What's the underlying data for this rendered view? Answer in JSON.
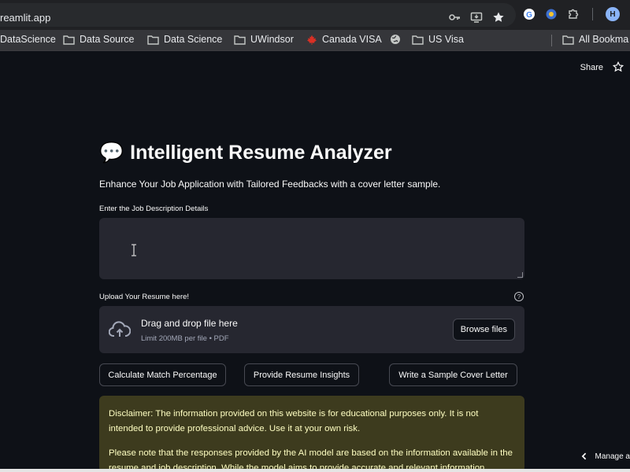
{
  "browser": {
    "url": "reamlit.app",
    "avatar_letter": "H",
    "bookmarks": [
      {
        "label": "DataScience",
        "icon": "folder-icon"
      },
      {
        "label": "Data Source",
        "icon": "folder-icon"
      },
      {
        "label": "Data Science",
        "icon": "folder-icon"
      },
      {
        "label": "UWindsor",
        "icon": "folder-icon"
      },
      {
        "label": "Canada VISA",
        "icon": "maple-leaf-icon"
      },
      {
        "label": "",
        "icon": "globe-icon"
      },
      {
        "label": "US Visa",
        "icon": "folder-icon"
      }
    ],
    "all_bookmarks": "All Bookma"
  },
  "toolbar": {
    "share": "Share"
  },
  "app": {
    "title_icon": "💬",
    "title": "Intelligent Resume Analyzer",
    "subtitle": "Enhance Your Job Application with Tailored Feedbacks with a cover letter sample.",
    "jd_label": "Enter the Job Description Details",
    "jd_value": "",
    "upload_label": "Upload Your Resume here!",
    "help_symbol": "?",
    "dropzone_title": "Drag and drop file here",
    "dropzone_limit": "Limit 200MB per file • PDF",
    "browse_label": "Browse files",
    "buttons": {
      "match": "Calculate Match Percentage",
      "insights": "Provide Resume Insights",
      "cover": "Write a Sample Cover Letter"
    },
    "disclaimer": [
      "Disclaimer: The information provided on this website is for educational purposes only. It is not intended to provide professional advice. Use it at your own risk.",
      "Please note that the responses provided by the AI model are based on the information available in the resume and job description. While the model aims to provide accurate and relevant information,"
    ]
  },
  "footer": {
    "manage": "Manage a"
  },
  "colors": {
    "background": "#0e1117",
    "widget": "#262730",
    "warning_bg": "#3d3b1e",
    "warning_text": "#ffffc2"
  }
}
